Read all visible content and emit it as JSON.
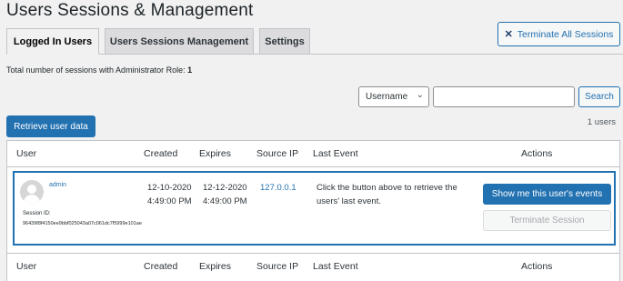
{
  "page": {
    "title": "Users Sessions & Management"
  },
  "tabs": [
    {
      "label": "Logged In Users",
      "active": true
    },
    {
      "label": "Users Sessions Management",
      "active": false
    },
    {
      "label": "Settings",
      "active": false
    }
  ],
  "toolbar": {
    "terminate_all_label": "Terminate All Sessions",
    "terminate_all_icon": "close-icon"
  },
  "summary": {
    "label": "Total number of sessions with Administrator Role:",
    "value": "1"
  },
  "search": {
    "filter_value": "Username",
    "input_value": "",
    "button_label": "Search"
  },
  "retrieve_label": "Retrieve user data",
  "count_label": "1 users",
  "table": {
    "columns": [
      "User",
      "Created",
      "Expires",
      "Source IP",
      "Last Event",
      "Actions"
    ],
    "rows": [
      {
        "username": "admin",
        "session_label": "Session ID:",
        "session_id": "96439f8f4150ee9bbf025043a07c061dc7f5999e101ae",
        "created": "12-10-2020 4:49:00 PM",
        "expires": "12-12-2020 4:49:00 PM",
        "source_ip": "127.0.0.1",
        "last_event": "Click the button above to retrieve the users' last event.",
        "events_button": "Show me this user's events",
        "terminate_button": "Terminate Session"
      }
    ]
  },
  "colors": {
    "accent": "#2271b1",
    "background": "#f1f1f1"
  }
}
